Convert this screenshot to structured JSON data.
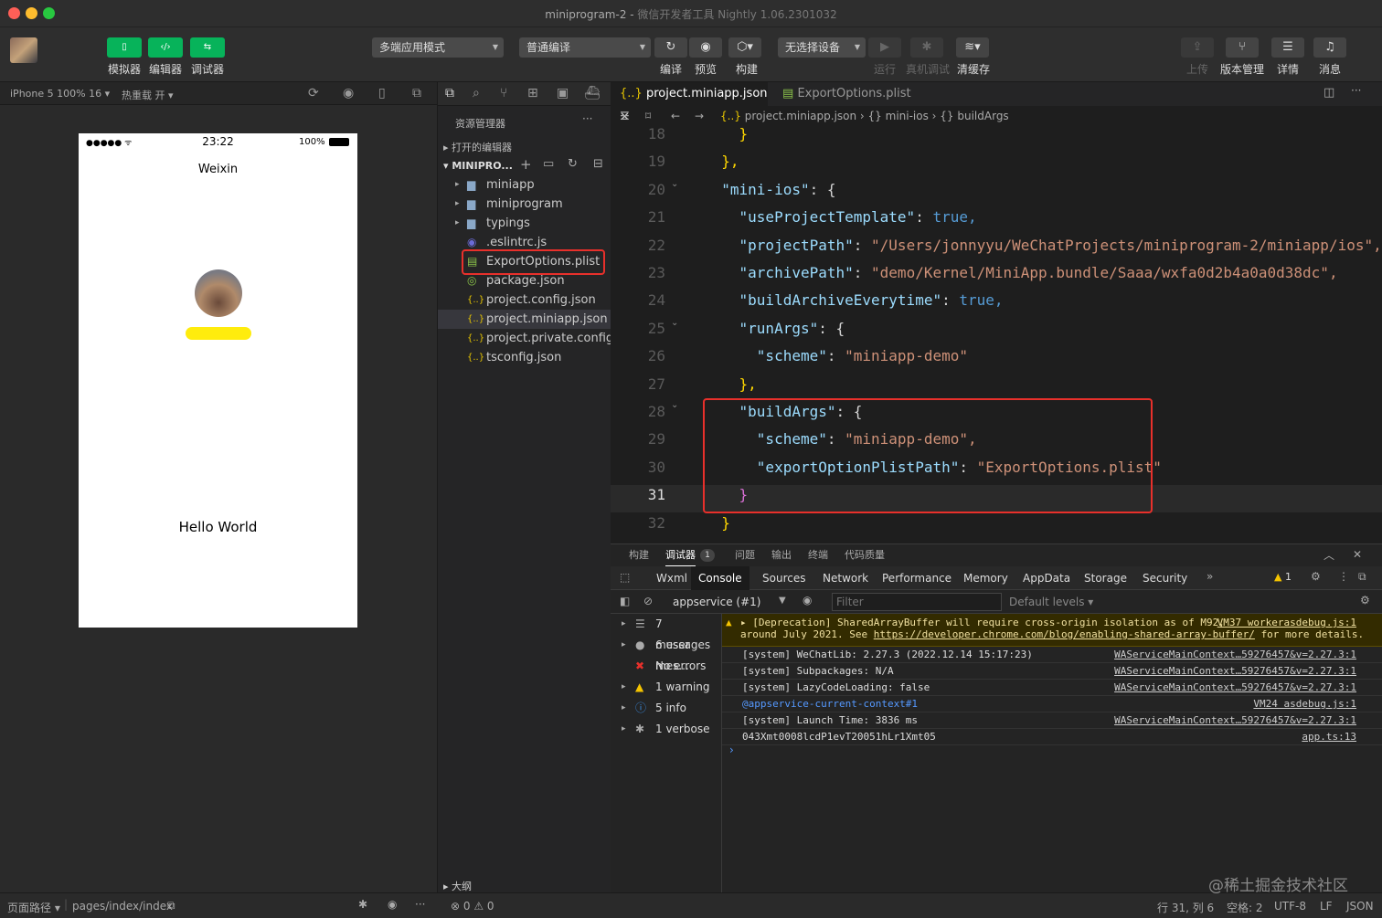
{
  "window": {
    "title": "miniprogram-2",
    "subtitle": "微信开发者工具 Nightly 1.06.2301032"
  },
  "toolbar": {
    "simulator": "模拟器",
    "editor": "编辑器",
    "debugger": "调试器",
    "mode_select": "多端应用模式",
    "compile_select": "普通编译",
    "compile": "编译",
    "preview": "预览",
    "build": "构建",
    "device_select": "无选择设备",
    "run": "运行",
    "real_debug": "真机调试",
    "clear_cache": "清缓存",
    "upload": "上传",
    "version": "版本管理",
    "details": "详情",
    "messages": "消息"
  },
  "simbar": {
    "device": "iPhone 5 100% 16",
    "hotreload": "热重载 开"
  },
  "phone": {
    "signal": "●●●●● ᯤ",
    "time": "23:22",
    "battery": "100%",
    "nav_title": "Weixin",
    "hello": "Hello World"
  },
  "explorer": {
    "header": "资源管理器",
    "open_editors": "打开的编辑器",
    "project": "MINIPRO...",
    "outline": "大纲",
    "items": [
      {
        "name": "miniapp",
        "icon": "folder-icon"
      },
      {
        "name": "miniprogram",
        "icon": "folder-icon"
      },
      {
        "name": "typings",
        "icon": "folder-icon"
      },
      {
        "name": ".eslintrc.js",
        "icon": "eslint-icon"
      },
      {
        "name": "ExportOptions.plist",
        "icon": "plist-icon"
      },
      {
        "name": "package.json",
        "icon": "npm-icon"
      },
      {
        "name": "project.config.json",
        "icon": "json-icon"
      },
      {
        "name": "project.miniapp.json",
        "icon": "json-icon"
      },
      {
        "name": "project.private.config...",
        "icon": "json-icon"
      },
      {
        "name": "tsconfig.json",
        "icon": "json-icon"
      }
    ]
  },
  "editor": {
    "tabs": [
      {
        "label": "project.miniapp.json"
      },
      {
        "label": "ExportOptions.plist"
      }
    ],
    "breadcrumb": {
      "file": "project.miniapp.json",
      "p1": "mini-ios",
      "p2": "buildArgs"
    },
    "lines": [
      {
        "n": "18",
        "indent": "    ",
        "k": "",
        "v": "}",
        "tail": ""
      },
      {
        "n": "19",
        "indent": "  ",
        "k": "",
        "v": "},",
        "tail": ""
      },
      {
        "n": "20",
        "indent": "  ",
        "k": "\"mini-ios\"",
        "v": ": {",
        "tail": ""
      },
      {
        "n": "21",
        "indent": "    ",
        "k": "\"useProjectTemplate\"",
        "v": ": ",
        "tail": "true,"
      },
      {
        "n": "22",
        "indent": "    ",
        "k": "\"projectPath\"",
        "v": ": ",
        "tail": "\"/Users/jonnyyu/WeChatProjects/miniprogram-2/miniapp/ios\","
      },
      {
        "n": "23",
        "indent": "    ",
        "k": "\"archivePath\"",
        "v": ": ",
        "tail": "\"demo/Kernel/MiniApp.bundle/Saaa/wxfa0d2b4a0a0d38dc\","
      },
      {
        "n": "24",
        "indent": "    ",
        "k": "\"buildArchiveEverytime\"",
        "v": ": ",
        "tail": "true,"
      },
      {
        "n": "25",
        "indent": "    ",
        "k": "\"runArgs\"",
        "v": ": {",
        "tail": ""
      },
      {
        "n": "26",
        "indent": "      ",
        "k": "\"scheme\"",
        "v": ": ",
        "tail": "\"miniapp-demo\""
      },
      {
        "n": "27",
        "indent": "    ",
        "k": "",
        "v": "},",
        "tail": ""
      },
      {
        "n": "28",
        "indent": "    ",
        "k": "\"buildArgs\"",
        "v": ": {",
        "tail": ""
      },
      {
        "n": "29",
        "indent": "      ",
        "k": "\"scheme\"",
        "v": ": ",
        "tail": "\"miniapp-demo\","
      },
      {
        "n": "30",
        "indent": "      ",
        "k": "\"exportOptionPlistPath\"",
        "v": ": ",
        "tail": "\"ExportOptions.plist\""
      },
      {
        "n": "31",
        "indent": "    ",
        "k": "",
        "v": "}",
        "tail": ""
      },
      {
        "n": "32",
        "indent": "  ",
        "k": "",
        "v": "}",
        "tail": ""
      }
    ]
  },
  "devtools": {
    "panel_tabs": [
      "构建",
      "调试器",
      "问题",
      "输出",
      "终端",
      "代码质量"
    ],
    "debugger_count": "1",
    "tabs": [
      "Wxml",
      "Console",
      "Sources",
      "Network",
      "Performance",
      "Memory",
      "AppData",
      "Storage",
      "Security"
    ],
    "warn_count": "1",
    "context": "appservice (#1)",
    "filter_placeholder": "Filter",
    "levels": "Default levels",
    "sidebar": [
      "7 messages",
      "6 user mes...",
      "No errors",
      "1 warning",
      "5 info",
      "1 verbose"
    ],
    "deprecation_line1": "[Deprecation] SharedArrayBuffer will require cross-origin isolation as of M92,",
    "deprecation_line2": "around July 2021. See",
    "deprecation_link": "https://developer.chrome.com/blog/enabling-shared-array-buffer/",
    "deprecation_tail": "for more details.",
    "deprecation_src": "VM37 workerasdebug.js:1",
    "logs": [
      {
        "text": "[system] WeChatLib: 2.27.3 (2022.12.14 15:17:23)",
        "src": "WAServiceMainContext…59276457&v=2.27.3:1"
      },
      {
        "text": "[system] Subpackages: N/A",
        "src": "WAServiceMainContext…59276457&v=2.27.3:1"
      },
      {
        "text": "[system] LazyCodeLoading: false",
        "src": "WAServiceMainContext…59276457&v=2.27.3:1"
      },
      {
        "text": "@appservice-current-context#1",
        "src": "VM24 asdebug.js:1"
      },
      {
        "text": "[system] Launch Time: 3836 ms",
        "src": "WAServiceMainContext…59276457&v=2.27.3:1"
      },
      {
        "text": "043Xmt0008lcdP1evT20051hLr1Xmt05",
        "src": "app.ts:13"
      }
    ],
    "prompt": "›"
  },
  "status": {
    "page_path_label": "页面路径",
    "page_path": "pages/index/index",
    "errors": "⊗ 0 ⚠ 0",
    "position": "行 31, 列 6",
    "spaces": "空格: 2",
    "encoding": "UTF-8",
    "eol": "LF",
    "lang": "JSON",
    "watermark": "@稀土掘金技术社区"
  }
}
